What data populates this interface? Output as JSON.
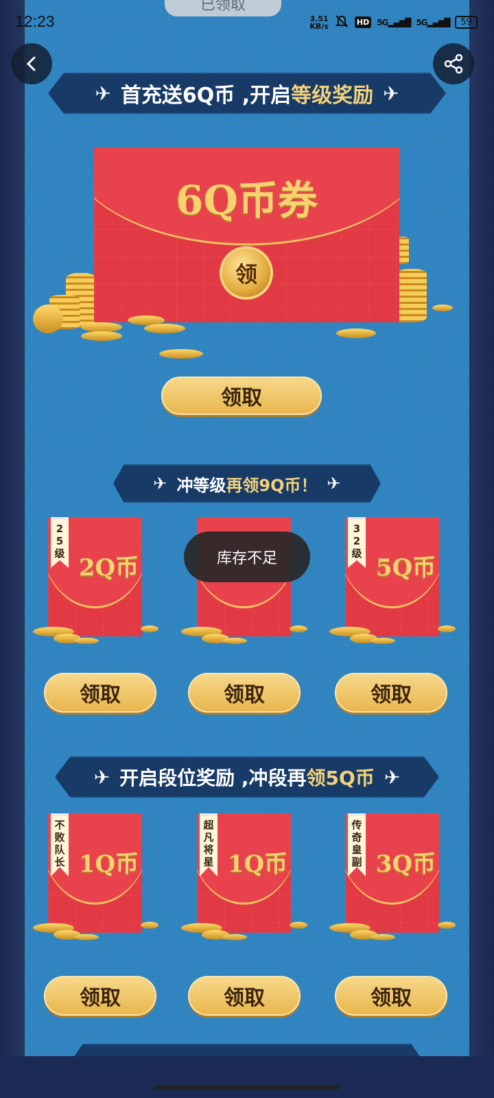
{
  "status_bar": {
    "time": "12:23",
    "net_speed_top": "3.51",
    "net_speed_unit": "KB/s",
    "hd_badge": "HD",
    "signal1": "5G",
    "signal2": "5G",
    "battery": "59"
  },
  "top_ghost_text": "已领取",
  "section1": {
    "title_prefix": "首充送6Q币 ,开启",
    "title_highlight": "等级奖励",
    "envelope_label": "6Q币券",
    "seal_text": "领",
    "claim_label": "领取"
  },
  "section2": {
    "title_prefix": "冲等级",
    "title_highlight": "再领9Q币！",
    "items": [
      {
        "tag": "25级",
        "amount": "2Q币",
        "claim_label": "领取"
      },
      {
        "tag": "",
        "amount": "",
        "claim_label": "领取"
      },
      {
        "tag": "32级",
        "amount": "5Q币",
        "claim_label": "领取"
      }
    ]
  },
  "toast": "库存不足",
  "section3": {
    "title_prefix": "开启段位奖励 ,冲段再",
    "title_highlight": "领5Q币",
    "items": [
      {
        "tag": "不败队长",
        "amount": "1Q币",
        "claim_label": "领取"
      },
      {
        "tag": "超凡将星",
        "amount": "1Q币",
        "claim_label": "领取"
      },
      {
        "tag": "传奇皇副",
        "amount": "3Q币",
        "claim_label": "领取"
      }
    ]
  },
  "colors": {
    "panel_blue": "#2f84c0",
    "ribbon_navy": "#173a66",
    "envelope_red": "#e23a44",
    "gold": "#f7d36f",
    "button_gold": "#e9b54c"
  }
}
